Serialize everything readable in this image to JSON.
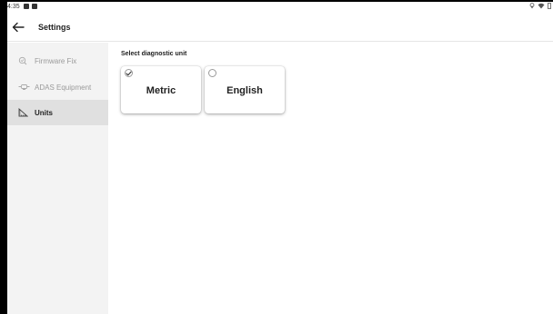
{
  "statusbar": {
    "time": "4:35"
  },
  "header": {
    "title": "Settings"
  },
  "sidebar": {
    "items": [
      {
        "label": "Firmware Fix",
        "icon": "firmware-icon",
        "active": false
      },
      {
        "label": "ADAS Equipment",
        "icon": "adas-icon",
        "active": false
      },
      {
        "label": "Units",
        "icon": "ruler-icon",
        "active": true
      }
    ]
  },
  "main": {
    "section_title": "Select diagnostic unit",
    "options": [
      {
        "label": "Metric",
        "selected": true
      },
      {
        "label": "English",
        "selected": false
      }
    ]
  },
  "colors": {
    "sidebar_bg": "#f3f3f3",
    "sidebar_active_bg": "#e0e0e0",
    "text_dark": "#222222",
    "text_muted": "#9a9a9a"
  }
}
